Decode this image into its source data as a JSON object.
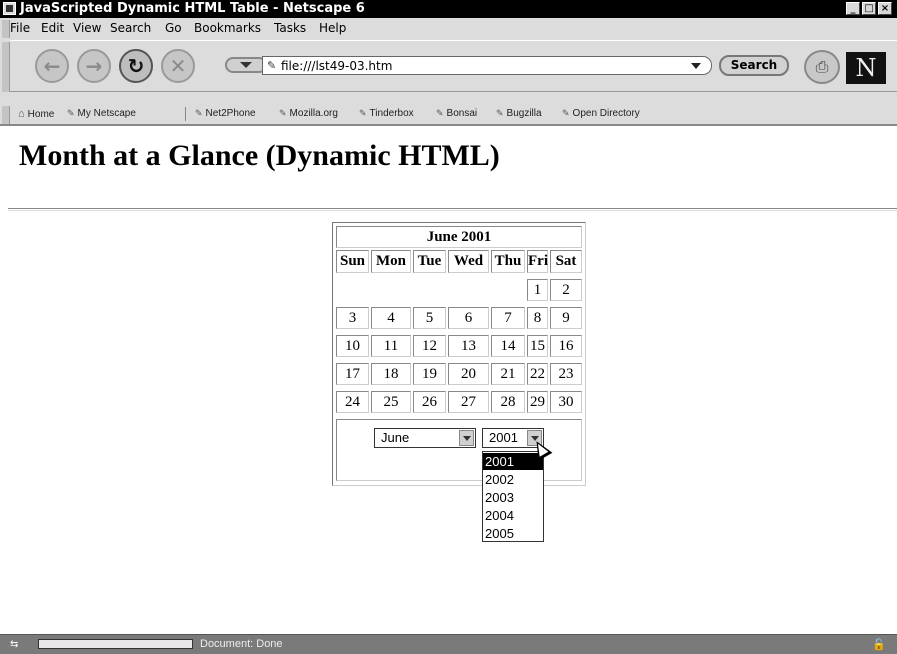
{
  "window": {
    "title": "JavaScripted Dynamic HTML Table - Netscape 6",
    "controls": [
      "minimize",
      "maximize",
      "close"
    ]
  },
  "menubar": [
    "File",
    "Edit",
    "View",
    "Search",
    "Go",
    "Bookmarks",
    "Tasks",
    "Help"
  ],
  "navigation": {
    "url": "file:///lst49-03.htm",
    "search_label": "Search",
    "brand_letter": "N"
  },
  "personal_toolbar": [
    "Home",
    "My Netscape",
    "Net2Phone",
    "Mozilla.org",
    "Tinderbox",
    "Bonsai",
    "Bugzilla",
    "Open Directory"
  ],
  "page": {
    "title": "Month at a Glance (Dynamic HTML)"
  },
  "calendar": {
    "caption": "June 2001",
    "day_headers": [
      "Sun",
      "Mon",
      "Tue",
      "Wed",
      "Thu",
      "Fri",
      "Sat"
    ],
    "weeks": [
      [
        "",
        "",
        "",
        "",
        "",
        "1",
        "2"
      ],
      [
        "3",
        "4",
        "5",
        "6",
        "7",
        "8",
        "9"
      ],
      [
        "10",
        "11",
        "12",
        "13",
        "14",
        "15",
        "16"
      ],
      [
        "17",
        "18",
        "19",
        "20",
        "21",
        "22",
        "23"
      ],
      [
        "24",
        "25",
        "26",
        "27",
        "28",
        "29",
        "30"
      ]
    ],
    "month_select": {
      "value": "June"
    },
    "year_select": {
      "value": "2001",
      "options": [
        "2001",
        "2002",
        "2003",
        "2004",
        "2005"
      ],
      "highlighted": "2001"
    }
  },
  "statusbar": {
    "text": "Document: Done"
  }
}
